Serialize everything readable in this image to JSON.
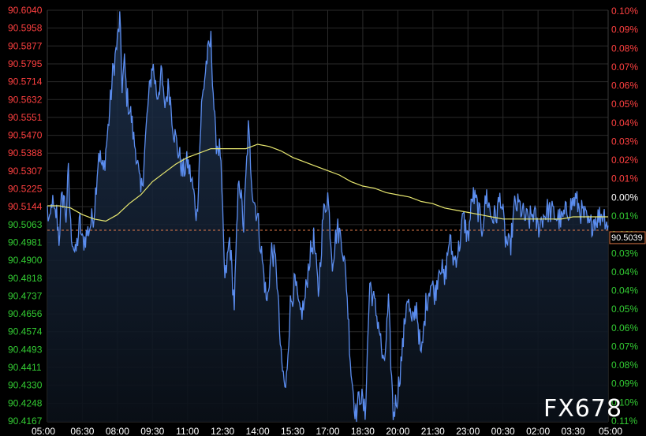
{
  "chart_data": {
    "type": "line",
    "title": "",
    "xlabel": "",
    "ylabel": "",
    "grid": true,
    "background": "#000000",
    "colors": {
      "price": "#5b8def",
      "price_fill_top": "#1f3350",
      "average": "#e8e870",
      "current_line": "#e07a4a",
      "label_positive": "#ff4040",
      "label_negative": "#33cc33",
      "label_zero": "#ffffff",
      "grid": "#2a2a2a"
    },
    "x_ticks": [
      "05:00",
      "06:30",
      "08:00",
      "09:30",
      "11:00",
      "12:30",
      "14:00",
      "15:30",
      "17:00",
      "18:30",
      "20:00",
      "21:30",
      "23:00",
      "00:30",
      "02:00",
      "03:30",
      "05:00"
    ],
    "y_ticks_left": [
      "90.6040",
      "90.5958",
      "90.5877",
      "90.5795",
      "90.5714",
      "90.5632",
      "90.5551",
      "90.5470",
      "90.5388",
      "90.5307",
      "90.5225",
      "90.5144",
      "90.5063",
      "90.4981",
      "90.4900",
      "90.4818",
      "90.4737",
      "90.4656",
      "90.4574",
      "90.4493",
      "90.4411",
      "90.4330",
      "90.4248",
      "90.4167"
    ],
    "y_ticks_right": [
      "0.10%",
      "0.09%",
      "0.08%",
      "0.07%",
      "0.06%",
      "0.05%",
      "0.04%",
      "0.03%",
      "0.02%",
      "0.01%",
      "0.00%",
      "0.01%",
      "0.02%",
      "0.03%",
      "0.04%",
      "0.04%",
      "0.05%",
      "0.06%",
      "0.07%",
      "0.08%",
      "0.09%",
      "0.10%",
      "0.11%"
    ],
    "reference_price": 90.514,
    "ylim": [
      90.4167,
      90.604
    ],
    "current_value": "90.5039",
    "price_series": {
      "x_hours": [
        0,
        0.1,
        0.2,
        0.3,
        0.4,
        0.5,
        0.6,
        0.7,
        0.8,
        0.9,
        1.0,
        1.2,
        1.4,
        1.5,
        1.6,
        1.8,
        2.0,
        2.2,
        2.4,
        2.6,
        2.8,
        3.0,
        3.1,
        3.2,
        3.3,
        3.4,
        3.5,
        3.6,
        3.7,
        3.8,
        3.9,
        4.0,
        4.1,
        4.3,
        4.5,
        4.7,
        4.9,
        5.0,
        5.2,
        5.4,
        5.6,
        5.8,
        6.0,
        6.2,
        6.4,
        6.6,
        6.8,
        7.0,
        7.2,
        7.4,
        7.6,
        7.8,
        8.0,
        8.2,
        8.4,
        8.6,
        8.8,
        9.0,
        9.2,
        9.4,
        9.6,
        9.8,
        10.0,
        10.2,
        10.4,
        10.6,
        10.8,
        11.0,
        11.2,
        11.4,
        11.6,
        11.8,
        12.0,
        12.2,
        12.4,
        12.6,
        12.8,
        13.0,
        13.2,
        13.4,
        13.6,
        13.8,
        14.0,
        14.2,
        14.4,
        14.6,
        14.8,
        15.0,
        15.2,
        15.4,
        15.6,
        15.8,
        16.0,
        16.2,
        16.4,
        16.6,
        16.8,
        17.0,
        17.2,
        17.4,
        17.6,
        17.8,
        18.0,
        18.2,
        18.4,
        18.6,
        18.8,
        19.0,
        19.2,
        19.4,
        19.6,
        19.8,
        20.0,
        20.2,
        20.4,
        20.6,
        20.8,
        21.0,
        21.2,
        21.4,
        21.6,
        21.8,
        22.0,
        22.2,
        22.4,
        22.6,
        22.8,
        23.0,
        23.2,
        23.4,
        23.6,
        23.8,
        24.0
      ],
      "values": [
        90.513,
        90.505,
        90.518,
        90.51,
        90.512,
        90.5,
        90.516,
        90.52,
        90.51,
        90.53,
        90.505,
        90.492,
        90.508,
        90.498,
        90.5,
        90.505,
        90.512,
        90.54,
        90.53,
        90.55,
        90.575,
        90.59,
        90.6,
        90.57,
        90.58,
        90.565,
        90.56,
        90.555,
        90.545,
        90.54,
        90.53,
        90.52,
        90.53,
        90.56,
        90.58,
        90.565,
        90.575,
        90.56,
        90.57,
        90.55,
        90.54,
        90.53,
        90.535,
        90.525,
        90.51,
        90.56,
        90.58,
        90.59,
        90.545,
        90.54,
        90.48,
        90.5,
        90.47,
        90.53,
        90.505,
        90.55,
        90.52,
        90.51,
        90.49,
        90.47,
        90.495,
        90.488,
        90.445,
        90.43,
        90.47,
        90.48,
        90.465,
        90.47,
        90.49,
        90.5,
        90.475,
        90.51,
        90.52,
        90.49,
        90.505,
        90.5,
        90.48,
        90.44,
        90.42,
        90.43,
        90.42,
        90.48,
        90.47,
        90.46,
        90.44,
        90.47,
        90.42,
        90.43,
        90.45,
        90.475,
        90.46,
        90.47,
        90.445,
        90.47,
        90.48,
        90.475,
        90.49,
        90.48,
        90.5,
        90.49,
        90.495,
        90.51,
        90.5,
        90.52,
        90.515,
        90.505,
        90.52,
        90.51,
        90.51,
        90.52,
        90.5,
        90.495,
        90.515,
        90.515,
        90.51,
        90.508,
        90.512,
        90.505,
        90.51,
        90.513,
        90.512,
        90.51,
        90.508,
        90.512,
        90.515,
        90.518,
        90.513,
        90.51,
        90.505,
        90.509,
        90.51,
        90.512,
        90.506
      ],
      "name": ""
    },
    "average_series": {
      "x_hours": [
        0,
        0.5,
        1.0,
        1.5,
        2.0,
        2.5,
        3.0,
        3.5,
        4.0,
        4.5,
        5.0,
        5.5,
        6.0,
        6.5,
        7.0,
        7.5,
        8.0,
        8.5,
        9.0,
        9.5,
        10.0,
        10.5,
        11.0,
        11.5,
        12.0,
        12.5,
        13.0,
        13.5,
        14.0,
        14.5,
        15.0,
        15.5,
        16.0,
        16.5,
        17.0,
        17.5,
        18.0,
        18.5,
        19.0,
        19.5,
        20.0,
        20.5,
        21.0,
        21.5,
        22.0,
        22.5,
        23.0,
        23.5,
        24.0
      ],
      "values": [
        90.515,
        90.515,
        90.514,
        90.511,
        90.509,
        90.508,
        90.511,
        90.516,
        90.52,
        90.526,
        90.53,
        90.534,
        90.537,
        90.539,
        90.541,
        90.541,
        90.541,
        90.541,
        90.543,
        90.542,
        90.54,
        90.537,
        90.535,
        90.533,
        90.531,
        90.529,
        90.526,
        90.524,
        90.523,
        90.521,
        90.52,
        90.519,
        90.517,
        90.516,
        90.514,
        90.513,
        90.512,
        90.511,
        90.51,
        90.509,
        90.509,
        90.509,
        90.509,
        90.509,
        90.509,
        90.51,
        90.51,
        90.51,
        90.51
      ]
    }
  },
  "watermark": "FX678"
}
